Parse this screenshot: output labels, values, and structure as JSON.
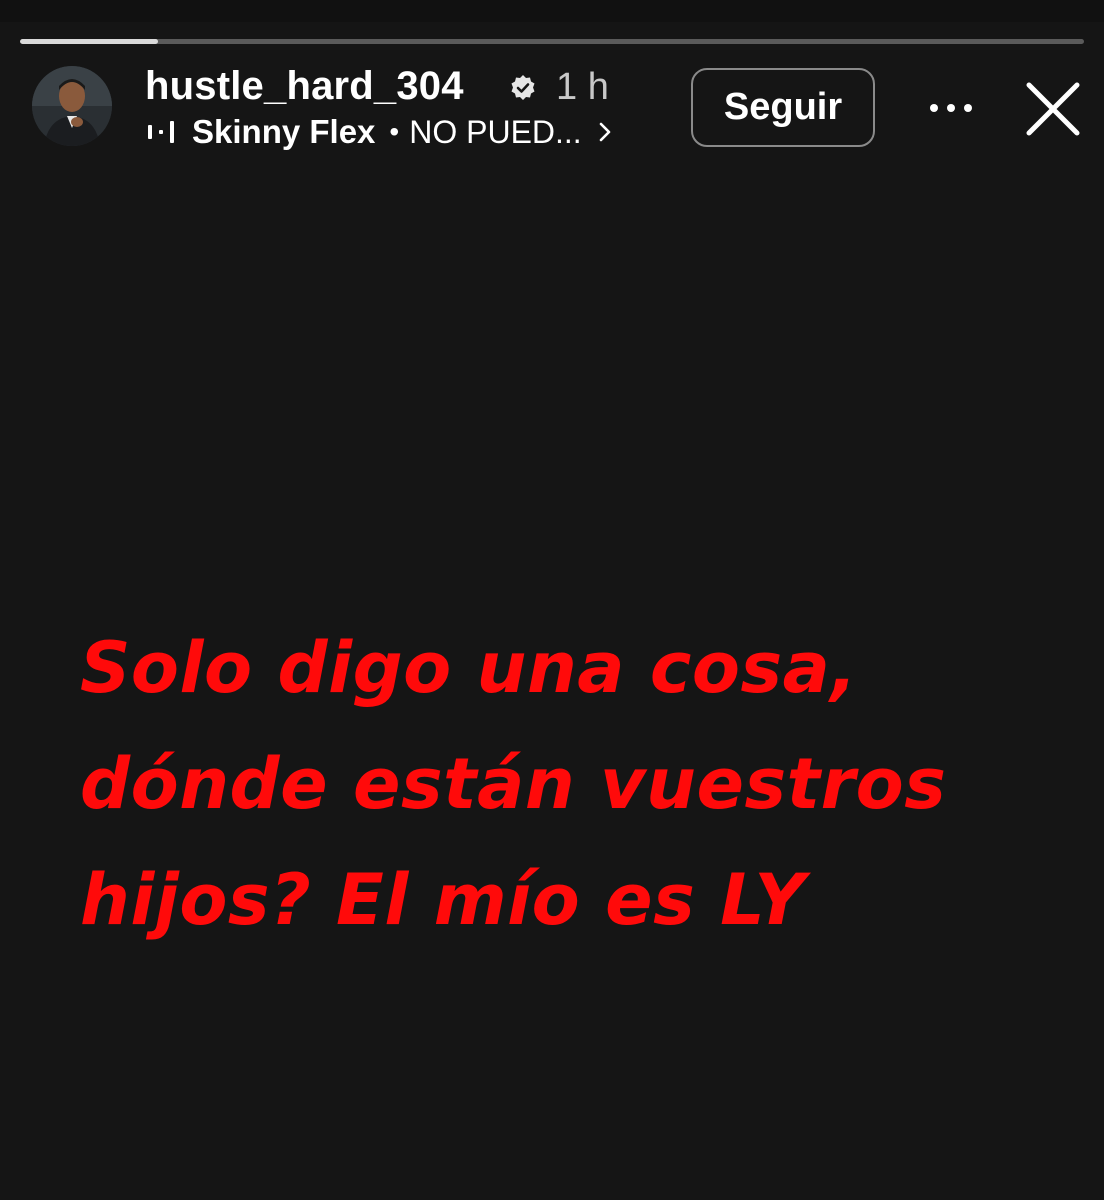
{
  "story": {
    "progress": 0.13,
    "colors": {
      "background": "#151515",
      "text": "#ff0a0a",
      "progress_fill": "#d9d9d9",
      "progress_track": "#5a5a5a"
    }
  },
  "header": {
    "username": "hustle_hard_304",
    "verified_icon": "verified-badge-icon",
    "timestamp": "1 h",
    "music": {
      "icon": "music-bars-icon",
      "artist": "Skinny Flex",
      "separator": "•",
      "song": "NO PUED...",
      "chevron_icon": "chevron-right-icon"
    },
    "follow_label": "Seguir",
    "more_icon": "more-dots-icon",
    "close_icon": "close-icon"
  },
  "content": {
    "lines": [
      "Solo digo una cosa,",
      "dónde están vuestros",
      "hijos? El mío es LY"
    ]
  }
}
